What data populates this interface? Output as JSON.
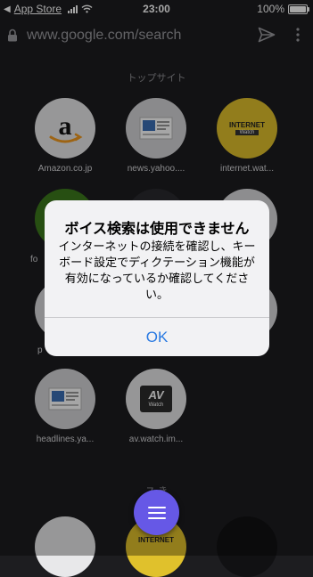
{
  "status_bar": {
    "back_label": "App Store",
    "time": "23:00",
    "battery": "100%"
  },
  "url_bar": {
    "url": "www.google.com/search"
  },
  "top_sites": {
    "heading": "トップサイト",
    "tiles": [
      {
        "label": "Amazon.co.jp",
        "icon": "amazon-logo-icon"
      },
      {
        "label": "news.yahoo....",
        "icon": "news-thumbnail-icon"
      },
      {
        "label": "internet.wat...",
        "icon": "internet-watch-icon"
      },
      {
        "label": "fo",
        "icon": "green-site-icon"
      },
      {
        "label": "p",
        "icon": "site-icon"
      },
      {
        "label": "headlines.ya...",
        "icon": "news-thumbnail-icon"
      },
      {
        "label": "av.watch.im...",
        "icon": "av-watch-icon"
      }
    ],
    "watch_brand": {
      "internet_line1": "INTERNET",
      "internet_line2": "Watch",
      "av_line1": "AV",
      "av_line2": "Watch"
    }
  },
  "second_section": {
    "heading": "ス         き"
  },
  "dialog": {
    "title": "ボイス検索は使用できません",
    "message": "インターネットの接続を確認し、キーボード設定でディクテーション機能が有効になっているか確認してください。",
    "ok_label": "OK"
  },
  "fab": {
    "icon": "menu-icon"
  },
  "colors": {
    "accent": "#6658e6",
    "link": "#2a7ae2",
    "background": "#1d1d20"
  }
}
